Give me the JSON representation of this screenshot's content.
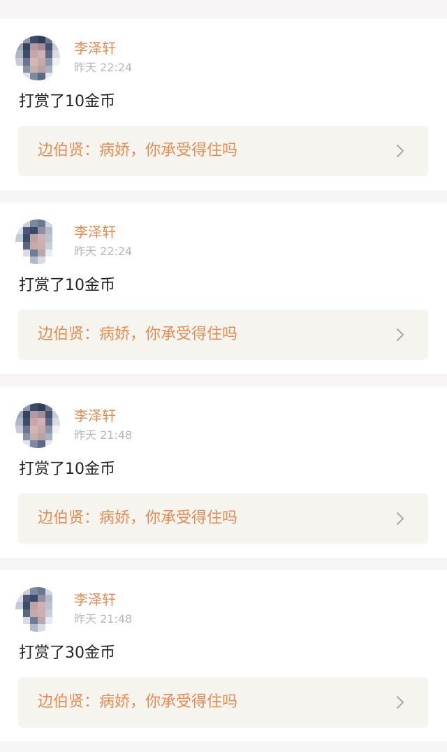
{
  "records": [
    {
      "user": "李泽轩",
      "time": "昨天 22:24",
      "message": "打赏了10金币",
      "book_link": "边伯贤：病娇，你承受得住吗"
    },
    {
      "user": "李泽轩",
      "time": "昨天 22:24",
      "message": "打赏了10金币",
      "book_link": "边伯贤：病娇，你承受得住吗"
    },
    {
      "user": "李泽轩",
      "time": "昨天 21:48",
      "message": "打赏了10金币",
      "book_link": "边伯贤：病娇，你承受得住吗"
    },
    {
      "user": "李泽轩",
      "time": "昨天 21:48",
      "message": "打赏了30金币",
      "book_link": "边伯贤：病娇，你承受得住吗"
    }
  ],
  "theme": {
    "accent": "#e88b54",
    "time_color": "#b8b8b8",
    "link_bg": "#f5f4ee",
    "page_bg": "#f7f5f5"
  },
  "icons": {
    "avatar": "pixelated-avatar-image",
    "chevron": "chevron-right-icon"
  }
}
